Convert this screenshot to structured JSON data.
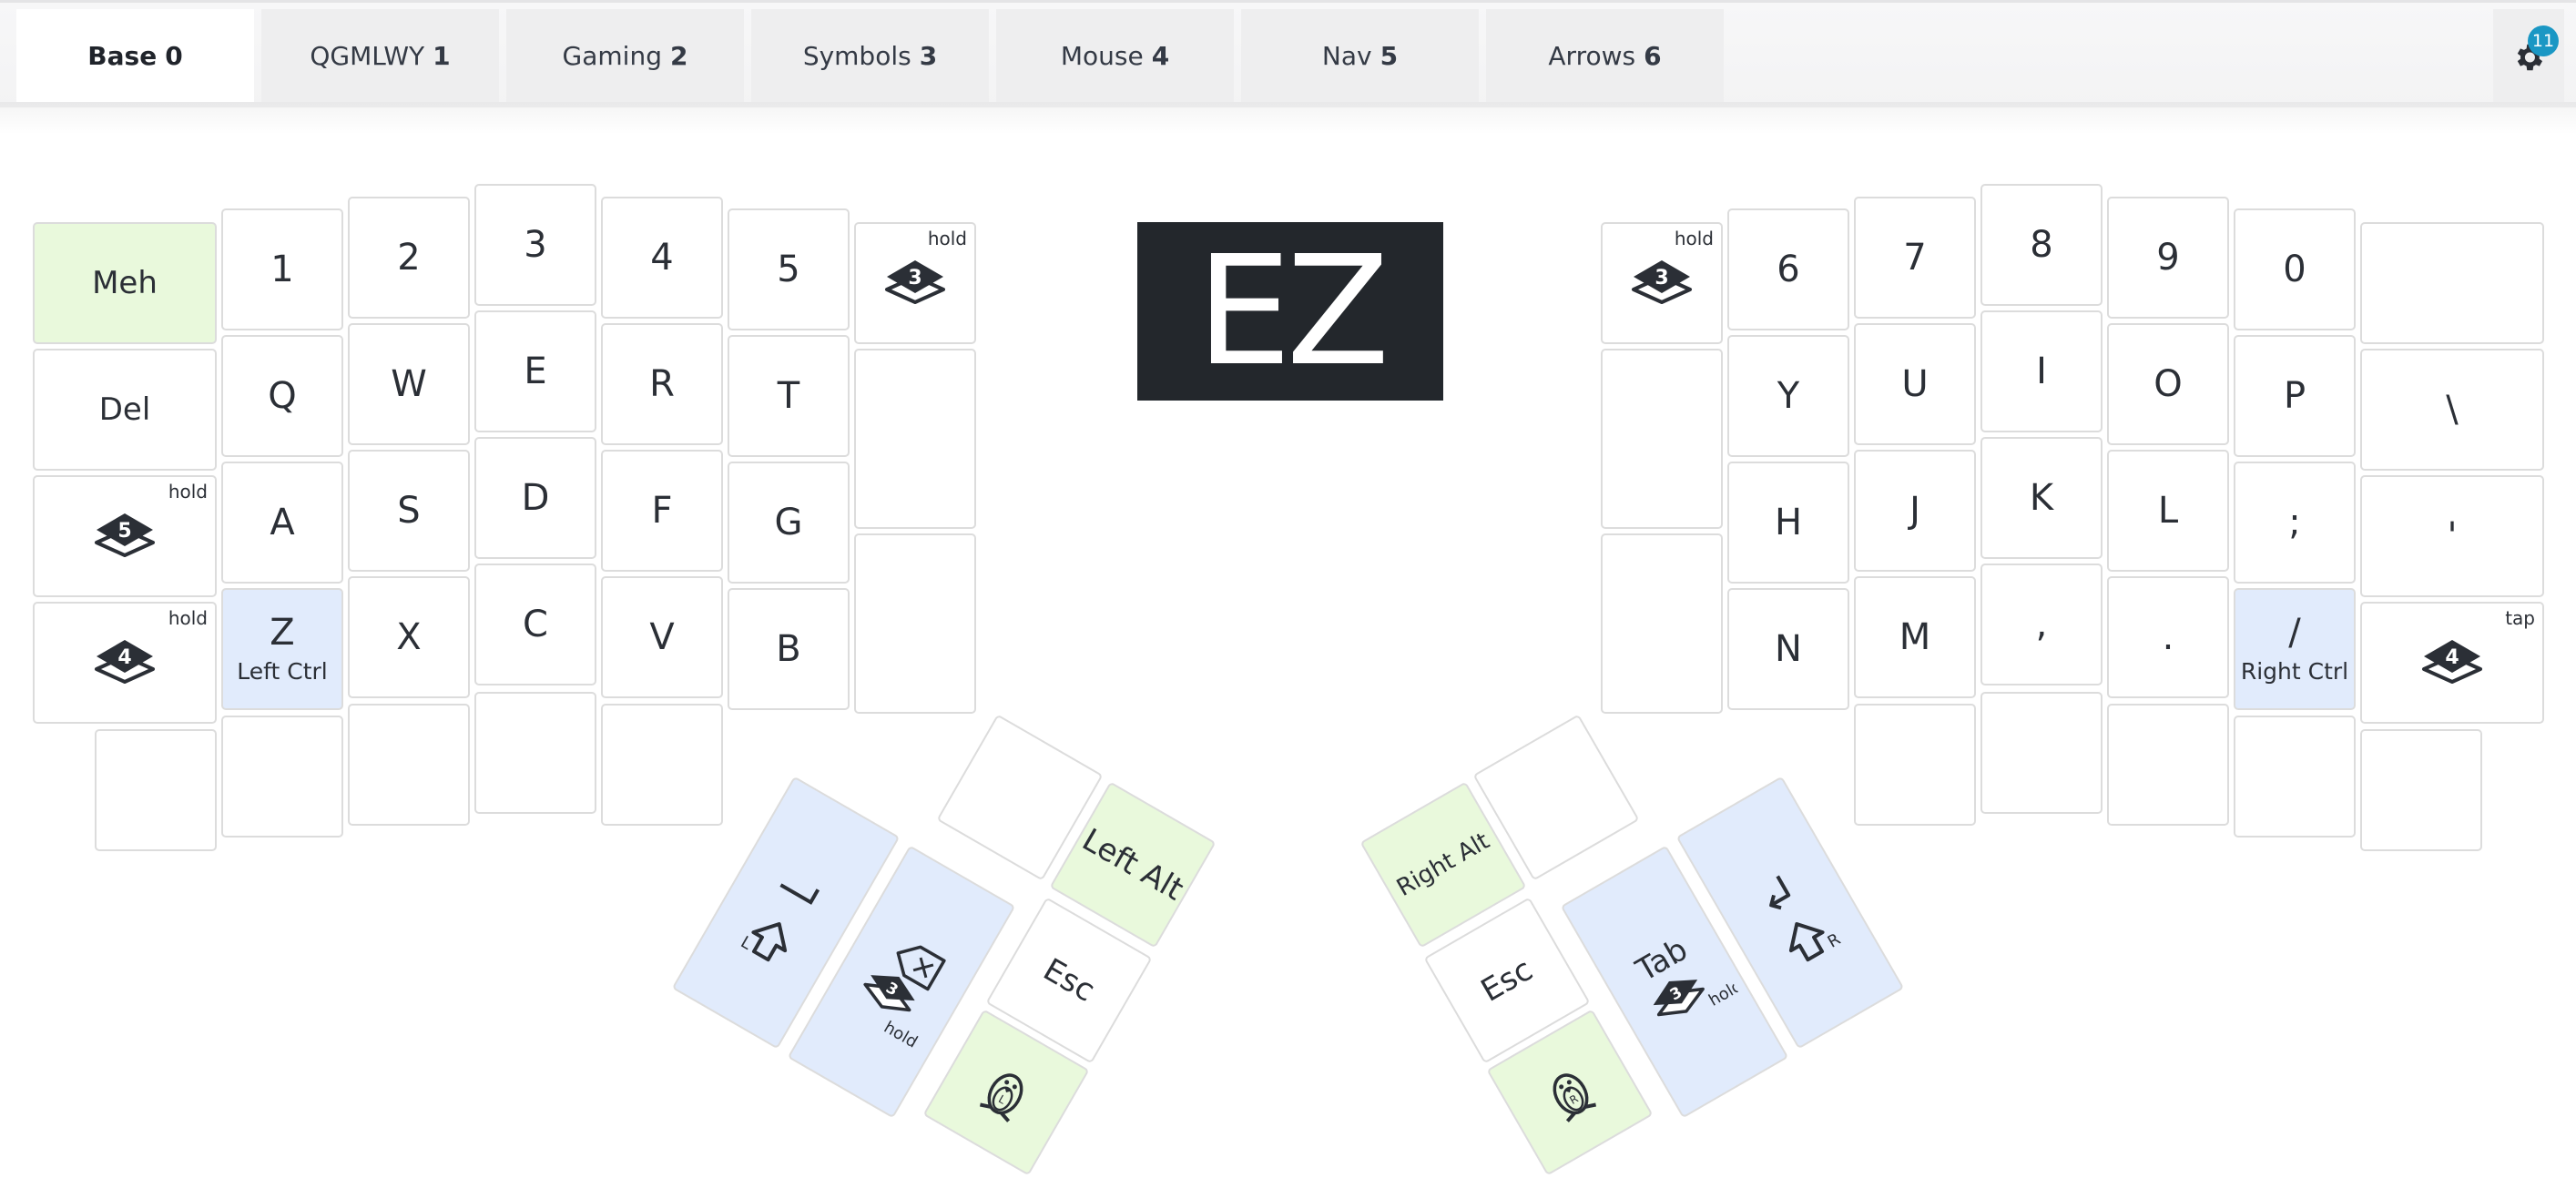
{
  "tabs": [
    {
      "label": "Base",
      "num": "0",
      "active": true
    },
    {
      "label": "QGMLWY",
      "num": "1"
    },
    {
      "label": "Gaming",
      "num": "2"
    },
    {
      "label": "Symbols",
      "num": "3"
    },
    {
      "label": "Mouse",
      "num": "4"
    },
    {
      "label": "Nav",
      "num": "5"
    },
    {
      "label": "Arrows",
      "num": "6"
    }
  ],
  "settings": {
    "badge": "11",
    "icon": "gear-icon"
  },
  "logo": "EZ",
  "keys": {
    "meh": "Meh",
    "del": "Del",
    "n1": "1",
    "n2": "2",
    "n3": "3",
    "n4": "4",
    "n5": "5",
    "q": "Q",
    "w": "W",
    "e": "E",
    "r": "R",
    "t": "T",
    "a": "A",
    "s": "S",
    "d": "D",
    "f": "F",
    "g": "G",
    "z": "Z",
    "z_mod": "Left Ctrl",
    "x": "X",
    "c": "C",
    "v": "V",
    "b": "B",
    "n6": "6",
    "n7": "7",
    "n8": "8",
    "n9": "9",
    "n0": "0",
    "y": "Y",
    "u": "U",
    "i": "I",
    "o": "O",
    "p": "P",
    "backslash": "\\",
    "h": "H",
    "j": "J",
    "k": "K",
    "l": "L",
    "semicolon": ";",
    "quote": "'",
    "n": "N",
    "m": "M",
    "comma": ",",
    "period": ".",
    "slash": "/",
    "slash_mod": "Right Ctrl",
    "hold": "hold",
    "tap": "tap",
    "layer3": "3",
    "layer4": "4",
    "layer5": "5",
    "left_alt": "Left Alt",
    "right_alt": "Right Alt",
    "esc": "Esc",
    "tab": "Tab",
    "shift_l": "L",
    "shift_r": "R",
    "super_l": "L",
    "super_r": "R"
  }
}
